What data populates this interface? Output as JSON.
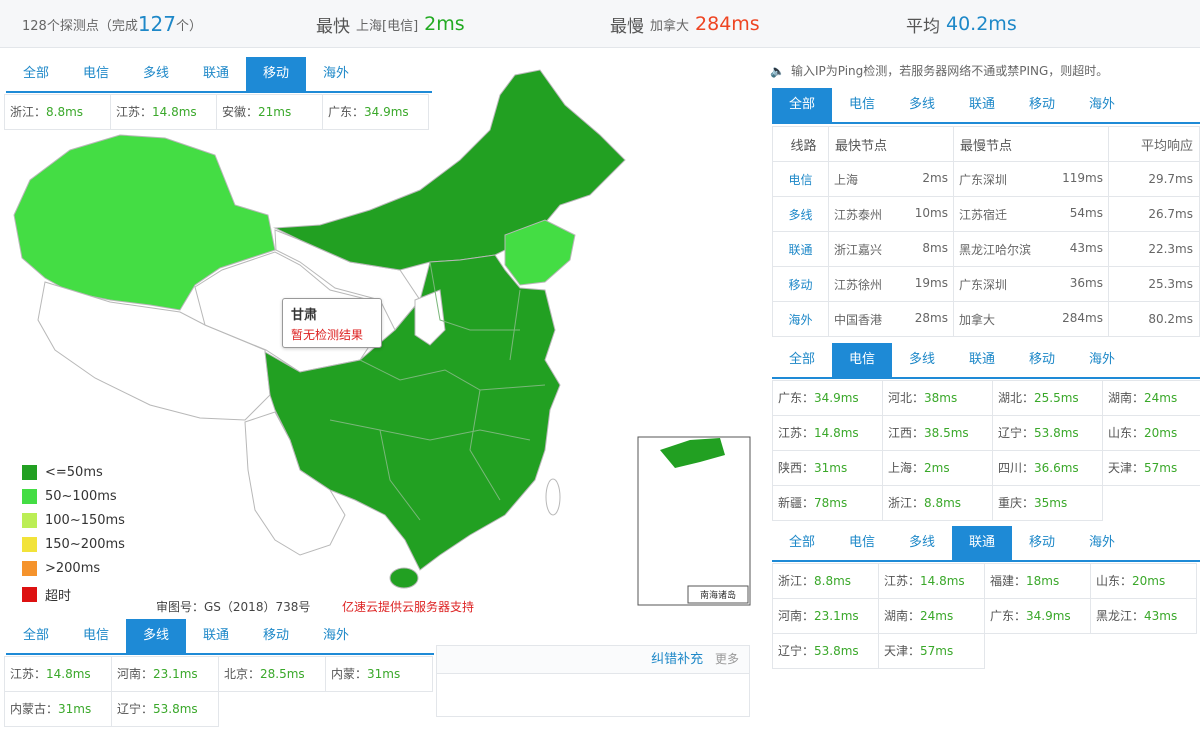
{
  "summary": {
    "nodes_prefix": "128个探测点（完成",
    "nodes_done": "127",
    "nodes_suffix": "个）",
    "fastest_label": "最快",
    "fastest_place": "上海[电信]",
    "fastest_value": "2ms",
    "slowest_label": "最慢",
    "slowest_place": "加拿大",
    "slowest_value": "284ms",
    "avg_label": "平均",
    "avg_value": "40.2ms"
  },
  "tab_labels": [
    "全部",
    "电信",
    "多线",
    "联通",
    "移动",
    "海外"
  ],
  "panel_mobile": {
    "active": 4,
    "items": [
      {
        "p": "浙江：",
        "v": "8.8ms"
      },
      {
        "p": "江苏：",
        "v": "14.8ms"
      },
      {
        "p": "安徽：",
        "v": "21ms"
      },
      {
        "p": "广东：",
        "v": "34.9ms"
      }
    ]
  },
  "panel_multi": {
    "active": 2,
    "items": [
      {
        "p": "江苏：",
        "v": "14.8ms"
      },
      {
        "p": "河南：",
        "v": "23.1ms"
      },
      {
        "p": "北京：",
        "v": "28.5ms"
      },
      {
        "p": "内蒙：",
        "v": "31ms"
      },
      {
        "p": "内蒙古：",
        "v": "31ms"
      },
      {
        "p": "辽宁：",
        "v": "53.8ms"
      }
    ]
  },
  "notice": "输入IP为Ping检测，若服务器网络不通或禁PING，则超时。",
  "summary_tabs_active": 0,
  "summary_table": {
    "headers": [
      "线路",
      "最快节点",
      "最慢节点",
      "平均响应"
    ],
    "rows": [
      {
        "line": "电信",
        "fast": "上海",
        "fast_v": "2ms",
        "slow": "广东深圳",
        "slow_v": "119ms",
        "avg": "29.7ms"
      },
      {
        "line": "多线",
        "fast": "江苏泰州",
        "fast_v": "10ms",
        "slow": "江苏宿迁",
        "slow_v": "54ms",
        "avg": "26.7ms"
      },
      {
        "line": "联通",
        "fast": "浙江嘉兴",
        "fast_v": "8ms",
        "slow": "黑龙江哈尔滨",
        "slow_v": "43ms",
        "avg": "22.3ms"
      },
      {
        "line": "移动",
        "fast": "江苏徐州",
        "fast_v": "19ms",
        "slow": "广东深圳",
        "slow_v": "36ms",
        "avg": "25.3ms"
      },
      {
        "line": "海外",
        "fast": "中国香港",
        "fast_v": "28ms",
        "slow": "加拿大",
        "slow_v": "284ms",
        "avg": "80.2ms"
      }
    ]
  },
  "panel_telecom": {
    "active": 1,
    "items": [
      {
        "p": "广东：",
        "v": "34.9ms"
      },
      {
        "p": "河北：",
        "v": "38ms"
      },
      {
        "p": "湖北：",
        "v": "25.5ms"
      },
      {
        "p": "湖南：",
        "v": "24ms"
      },
      {
        "p": "江苏：",
        "v": "14.8ms"
      },
      {
        "p": "江西：",
        "v": "38.5ms"
      },
      {
        "p": "辽宁：",
        "v": "53.8ms"
      },
      {
        "p": "山东：",
        "v": "20ms"
      },
      {
        "p": "陕西：",
        "v": "31ms"
      },
      {
        "p": "上海：",
        "v": "2ms"
      },
      {
        "p": "四川：",
        "v": "36.6ms"
      },
      {
        "p": "天津：",
        "v": "57ms"
      },
      {
        "p": "新疆：",
        "v": "78ms"
      },
      {
        "p": "浙江：",
        "v": "8.8ms"
      },
      {
        "p": "重庆：",
        "v": "35ms"
      }
    ]
  },
  "panel_unicom": {
    "active": 3,
    "items": [
      {
        "p": "浙江：",
        "v": "8.8ms"
      },
      {
        "p": "江苏：",
        "v": "14.8ms"
      },
      {
        "p": "福建：",
        "v": "18ms"
      },
      {
        "p": "山东：",
        "v": "20ms"
      },
      {
        "p": "河南：",
        "v": "23.1ms"
      },
      {
        "p": "湖南：",
        "v": "24ms"
      },
      {
        "p": "广东：",
        "v": "34.9ms"
      },
      {
        "p": "黑龙江：",
        "v": "43ms"
      },
      {
        "p": "辽宁：",
        "v": "53.8ms"
      },
      {
        "p": "天津：",
        "v": "57ms"
      }
    ]
  },
  "map": {
    "tooltip_title": "甘肃",
    "tooltip_text": "暂无检测结果",
    "legend": [
      {
        "label": "<=50ms",
        "color": "#22a022"
      },
      {
        "label": "50~100ms",
        "color": "#44dd44"
      },
      {
        "label": "100~150ms",
        "color": "#bbee55"
      },
      {
        "label": "150~200ms",
        "color": "#f2e33a"
      },
      {
        "label": ">200ms",
        "color": "#f5932c"
      },
      {
        "label": "超时",
        "color": "#dd1111"
      }
    ],
    "inset_label": "南海诸岛",
    "colors": {
      "strong": "#22a022",
      "medium": "#44dd44",
      "none": "#ffffff",
      "border": "#b8b8b8"
    }
  },
  "credits": {
    "approval": "审图号：GS（2018）738号",
    "support": "亿速云提供云服务器支持"
  },
  "feedback": {
    "correct": "纠错补充",
    "more": "更多"
  }
}
